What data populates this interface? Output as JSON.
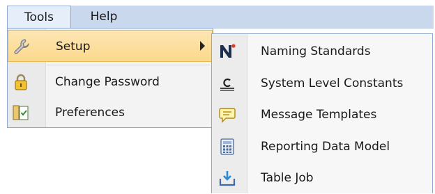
{
  "menubar": {
    "tools_label": "Tools",
    "help_label": "Help"
  },
  "tools_menu": {
    "items": [
      {
        "label": "Setup",
        "icon": "wrench-icon",
        "has_submenu": true,
        "highlighted": true
      },
      {
        "label": "Change Password",
        "icon": "padlock-icon"
      },
      {
        "label": "Preferences",
        "icon": "preferences-checklist-icon"
      }
    ]
  },
  "setup_submenu": {
    "items": [
      {
        "label": "Naming Standards",
        "icon": "n-logo-icon"
      },
      {
        "label": "System Level Constants",
        "icon": "constants-c-icon"
      },
      {
        "label": "Message Templates",
        "icon": "speech-bubble-icon"
      },
      {
        "label": "Reporting Data Model",
        "icon": "calculator-icon"
      },
      {
        "label": "Table Job",
        "icon": "download-arrow-icon"
      }
    ]
  },
  "colors": {
    "menubar_bg": "#c9d8ec",
    "menu_border": "#8fa9cf",
    "highlight_bg": "#fbd98c",
    "highlight_border": "#e8b94f"
  }
}
